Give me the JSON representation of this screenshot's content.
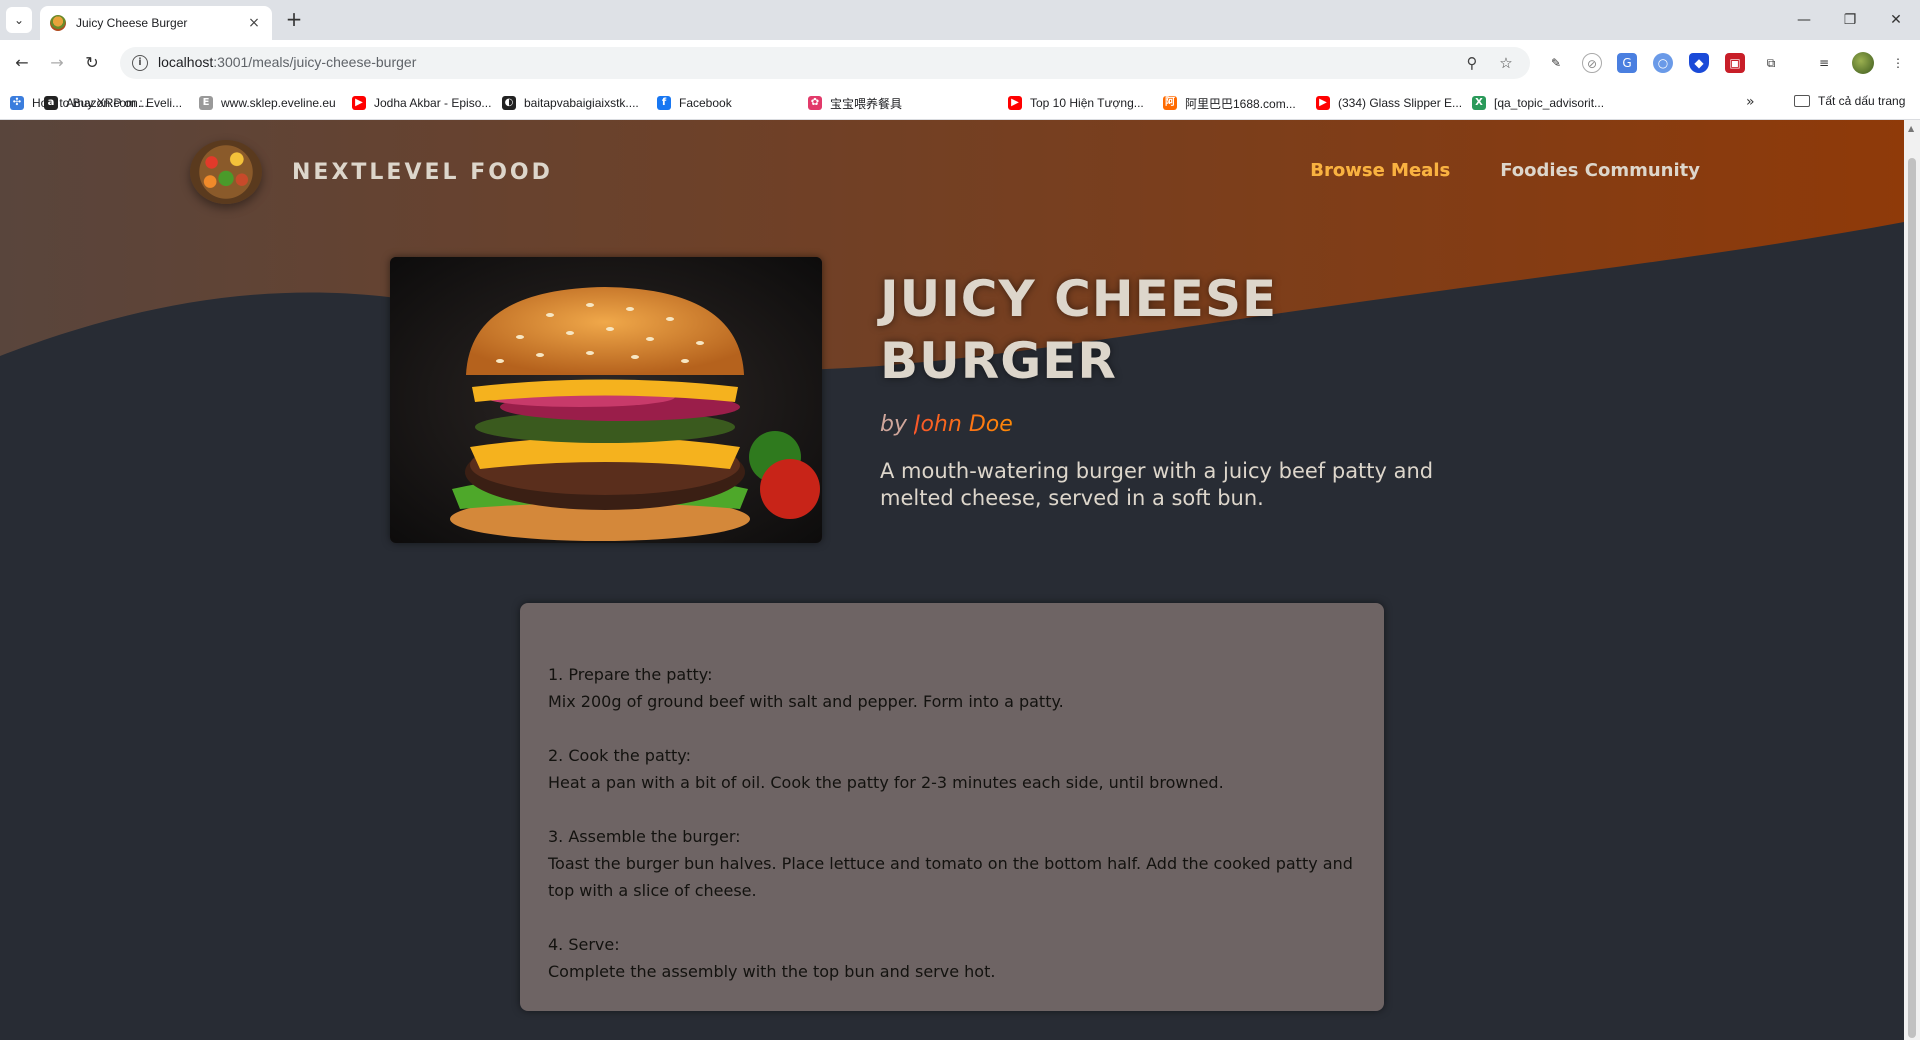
{
  "browser": {
    "tab_title": "Juicy Cheese Burger",
    "tab_close": "×",
    "new_tab": "+",
    "url_host": "localhost",
    "url_path": ":3001/meals/juicy-cheese-burger",
    "bookmarks": [
      {
        "label": "How to Buy XRP on...",
        "color": "#3b7ddd",
        "glyph": "✣"
      },
      {
        "label": "Amazon.com : Eveli...",
        "color": "#222222",
        "glyph": "a"
      },
      {
        "label": "www.sklep.eveline.eu",
        "color": "#999999",
        "glyph": "E"
      },
      {
        "label": "Jodha Akbar - Episo...",
        "color": "#ff0000",
        "glyph": "▶"
      },
      {
        "label": "baitapvabaigiaixstk....",
        "color": "#222222",
        "glyph": "◐"
      },
      {
        "label": "Facebook",
        "color": "#1877f2",
        "glyph": "f"
      },
      {
        "label": "宝宝喂养餐具",
        "color": "#e23a6a",
        "glyph": "✿"
      },
      {
        "label": "Top 10 Hiện Tượng...",
        "color": "#ff0000",
        "glyph": "▶"
      },
      {
        "label": "阿里巴巴1688.com...",
        "color": "#ff6a00",
        "glyph": "阿"
      },
      {
        "label": "(334) Glass Slipper E...",
        "color": "#ff0000",
        "glyph": "▶"
      },
      {
        "label": "[qa_topic_advisorit...",
        "color": "#2a9a5a",
        "glyph": "X"
      }
    ],
    "more_bookmarks": "»",
    "all_bookmarks": "Tất cả dấu trang"
  },
  "site": {
    "logo_text": "NEXTLEVEL FOOD",
    "nav": [
      {
        "label": "Browse Meals",
        "active": true
      },
      {
        "label": "Foodies Community",
        "active": false
      }
    ]
  },
  "meal": {
    "title": "Juicy Cheese Burger",
    "by": "by",
    "creator": "John Doe",
    "summary": "A mouth-watering burger with a juicy beef patty and melted cheese, served in a soft bun.",
    "instructions": [
      {
        "title": "1. Prepare the patty:",
        "body": "Mix 200g of ground beef with salt and pepper. Form into a patty."
      },
      {
        "title": "2. Cook the patty:",
        "body": "Heat a pan with a bit of oil. Cook the patty for 2-3 minutes each side, until browned."
      },
      {
        "title": "3. Assemble the burger:",
        "body": "Toast the burger bun halves. Place lettuce and tomato on the bottom half. Add the cooked patty and top with a slice of cheese."
      },
      {
        "title": "4. Serve:",
        "body": "Complete the assembly with the top bun and serve hot."
      }
    ]
  },
  "colors": {
    "page_bg": "#282c34",
    "header_wave_start": "#5a3a2e",
    "header_wave_end": "#8c3b0d",
    "accent": "#ff9b05",
    "text": "#ddd6cb",
    "instructions_bg": "#6e6464"
  }
}
